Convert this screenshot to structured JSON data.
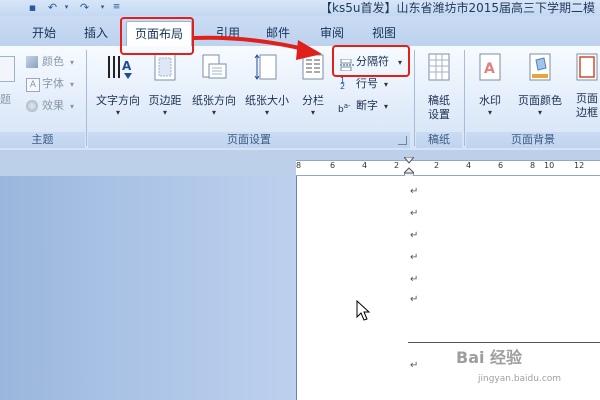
{
  "window": {
    "title": "【ks5u首发】山东省潍坊市2015届高三下学期二模"
  },
  "quick_access": {
    "save_icon": "save-icon",
    "undo_icon": "undo-icon",
    "redo_icon": "redo-icon"
  },
  "tabs": [
    {
      "label": "开始"
    },
    {
      "label": "插入"
    },
    {
      "label": "页面布局",
      "selected": true
    },
    {
      "label": "引用"
    },
    {
      "label": "邮件"
    },
    {
      "label": "审阅"
    },
    {
      "label": "视图"
    }
  ],
  "ribbon": {
    "theme_group": {
      "label": "主题",
      "partial_label": "题",
      "colors": "颜色",
      "fonts": "字体",
      "effects": "效果"
    },
    "page_setup_group": {
      "label": "页面设置",
      "text_direction": "文字方向",
      "margins": "页边距",
      "orientation": "纸张方向",
      "size": "纸张大小",
      "columns": "分栏",
      "breaks": "分隔符",
      "line_numbers": "行号",
      "hyphenation": "断字"
    },
    "manuscript_group": {
      "label": "稿纸",
      "manuscript_setup": "稿纸\n设置"
    },
    "page_background_group": {
      "label": "页面背景",
      "watermark": "水印",
      "page_color": "页面颜色",
      "page_borders_line1": "页面",
      "page_borders_line2": "边框"
    }
  },
  "ruler": {
    "ticks": [
      "8",
      "6",
      "4",
      "2",
      "2",
      "4",
      "6",
      "8",
      "10",
      "12"
    ]
  },
  "document": {
    "paragraph_mark": "↵"
  },
  "watermark_text": {
    "main": "Bai 经验",
    "sub": "jingyan.baidu.com"
  },
  "colors": {
    "annotation_red": "#e0201b",
    "ribbon_blue": "#bdd2ee"
  }
}
